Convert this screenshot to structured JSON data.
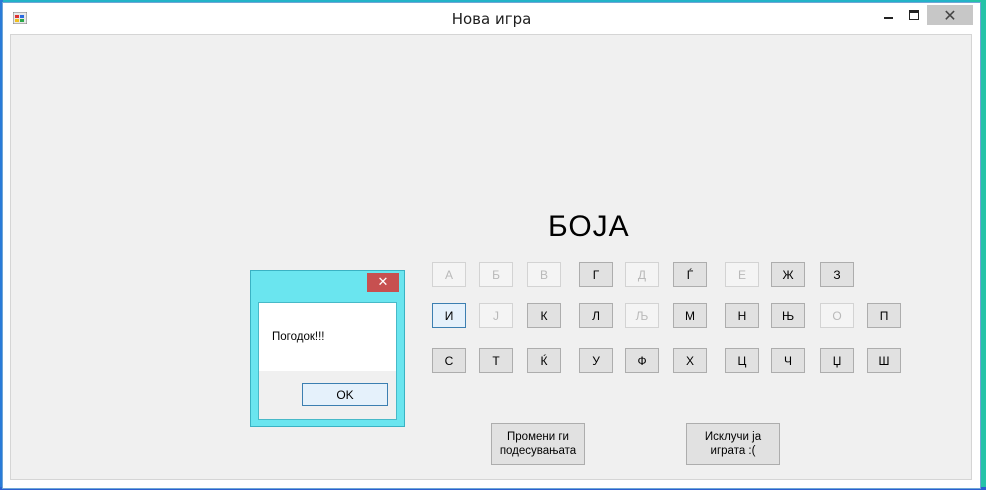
{
  "window": {
    "title": "Нова игра",
    "close_glyph": "✕"
  },
  "game": {
    "word": "БОЈА"
  },
  "keyboard": {
    "row1": [
      {
        "letter": "А",
        "state": "disabled"
      },
      {
        "letter": "Б",
        "state": "disabled"
      },
      {
        "letter": "В",
        "state": "disabled"
      },
      {
        "letter": "Г",
        "state": "enabled"
      },
      {
        "letter": "Д",
        "state": "disabled"
      },
      {
        "letter": "Ѓ",
        "state": "enabled"
      },
      {
        "letter": "Е",
        "state": "disabled"
      },
      {
        "letter": "Ж",
        "state": "enabled"
      },
      {
        "letter": "З",
        "state": "enabled"
      }
    ],
    "row2": [
      {
        "letter": "И",
        "state": "focused"
      },
      {
        "letter": "Ј",
        "state": "disabled"
      },
      {
        "letter": "К",
        "state": "enabled"
      },
      {
        "letter": "Л",
        "state": "enabled"
      },
      {
        "letter": "Љ",
        "state": "disabled"
      },
      {
        "letter": "М",
        "state": "enabled"
      },
      {
        "letter": "Н",
        "state": "enabled"
      },
      {
        "letter": "Њ",
        "state": "enabled"
      },
      {
        "letter": "О",
        "state": "disabled"
      },
      {
        "letter": "П",
        "state": "enabled"
      }
    ],
    "row3": [
      {
        "letter": "С",
        "state": "enabled"
      },
      {
        "letter": "Т",
        "state": "enabled"
      },
      {
        "letter": "Ќ",
        "state": "enabled"
      },
      {
        "letter": "У",
        "state": "enabled"
      },
      {
        "letter": "Ф",
        "state": "enabled"
      },
      {
        "letter": "Х",
        "state": "enabled"
      },
      {
        "letter": "Ц",
        "state": "enabled"
      },
      {
        "letter": "Ч",
        "state": "enabled"
      },
      {
        "letter": "Џ",
        "state": "enabled"
      },
      {
        "letter": "Ш",
        "state": "enabled"
      }
    ]
  },
  "actions": {
    "settings_label": "Промени ги\nподесувањата",
    "exit_label": "Исклучи ја\nиграта :("
  },
  "dialog": {
    "message": "Погодок!!!",
    "ok_label": "OK",
    "close_glyph": "✕"
  },
  "colors": {
    "dialog_frame": "#6ae5ef",
    "dialog_close": "#c75050",
    "focus_border": "#3c7fb1"
  },
  "icons": {
    "app": "app-icon",
    "minimize": "minimize-icon",
    "maximize": "maximize-icon",
    "close": "close-icon"
  }
}
